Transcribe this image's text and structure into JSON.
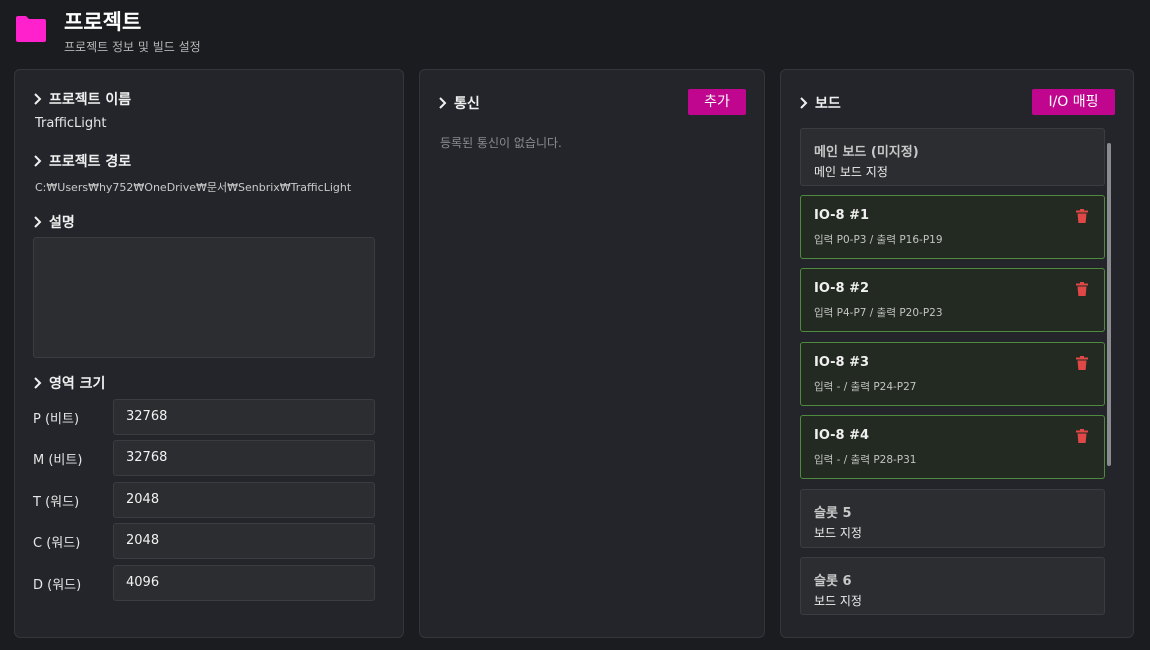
{
  "header": {
    "title": "프로젝트",
    "subtitle": "프로젝트 정보 및 빌드 설정",
    "icon": "folder-icon",
    "accent": "#ff22cc"
  },
  "project": {
    "name_label": "프로젝트 이름",
    "name_value": "TrafficLight",
    "path_label": "프로젝트 경로",
    "path_value": "C:₩Users₩hy752₩OneDrive₩문서₩Senbrix₩TrafficLight",
    "desc_label": "설명",
    "desc_value": "",
    "area_label": "영역 크기",
    "fields": [
      {
        "label": "P (비트)",
        "value": "32768"
      },
      {
        "label": "M (비트)",
        "value": "32768"
      },
      {
        "label": "T (워드)",
        "value": "2048"
      },
      {
        "label": "C (워드)",
        "value": "2048"
      },
      {
        "label": "D (워드)",
        "value": "4096"
      }
    ]
  },
  "comm": {
    "label": "통신",
    "add_button": "추가",
    "empty_text": "등록된 통신이 없습니다."
  },
  "board": {
    "label": "보드",
    "io_button": "I/O 매핑",
    "cards": [
      {
        "title": "메인 보드 (미지정)",
        "sub": "메인 보드 지정",
        "active": false
      },
      {
        "title": "IO-8 #1",
        "sub": "입력 P0-P3 / 출력 P16-P19",
        "active": true
      },
      {
        "title": "IO-8 #2",
        "sub": "입력 P4-P7 / 출력 P20-P23",
        "active": true
      },
      {
        "title": "IO-8 #3",
        "sub": "입력 - / 출력 P24-P27",
        "active": true
      },
      {
        "title": "IO-8 #4",
        "sub": "입력 - / 출력 P28-P31",
        "active": true
      },
      {
        "title": "슬롯 5",
        "sub": "보드 지정",
        "active": false
      },
      {
        "title": "슬롯 6",
        "sub": "보드 지정",
        "active": false
      }
    ]
  },
  "colors": {
    "button": "#c0068f",
    "active_border": "#4f8a3e",
    "delete": "#e04848"
  }
}
